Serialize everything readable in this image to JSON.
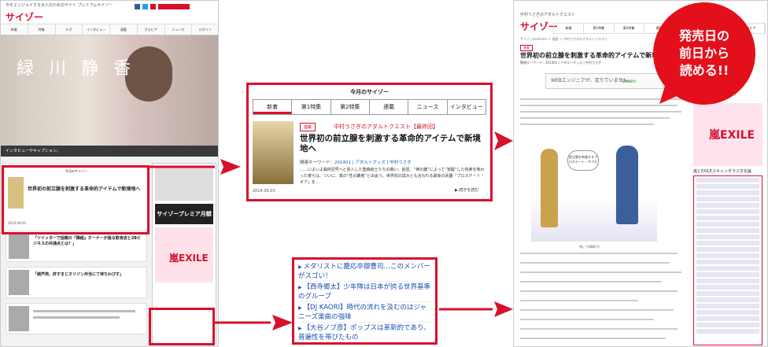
{
  "left_page": {
    "tagline": "今をエンジョイする大人のためのサイト プレミアムサイゾー",
    "logo": "サイゾー",
    "logo_sub": "premium",
    "nav": [
      "新着",
      "特集",
      "ルポ",
      "インタビュー",
      "連載",
      "グラビア",
      "ニュース",
      "ログイン"
    ],
    "hero_name": "緑 川 静 香",
    "hero_caption": "インタビューやキャプション。",
    "widget_header": "今月のサイゾー",
    "widget_tabs": [
      "新着",
      "第1特集",
      "第2特集",
      "連載",
      "ニュース",
      "インタビュー"
    ],
    "widget_title": "世界初の前立腺を刺激する革命的アイテムで新境地へ",
    "widget_date": "2014.09.03",
    "side_ad": "サイゾープレミア月額540円",
    "side_cover": "嵐EXILE",
    "news_titles": [
      "「ツイッターで話題の『隣組』オーナーが語る飲食店と2Bビジネスの共通点とは？」",
      "「諸芦苑、許すまじオリジン弁当にて待ちわびす」"
    ]
  },
  "popup_feature": {
    "header": "今月のサイゾー",
    "tabs": [
      "新着",
      "第1特集",
      "第2特集",
      "連載",
      "ニュース",
      "インタビュー"
    ],
    "badge": "連載",
    "category": "中村うさぎのアダルトクエスト【最終回】",
    "title": "世界初の前立腺を刺激する革命的アイテムで新境地へ",
    "keywords_label": "関連キーワード：",
    "keywords": "201401 | アダルトグッズ | 中村うさぎ",
    "body": "……いよいよ最終回号へと突入した重森純士たちの戦い。前回、“神の器”によって“覚醒”した快楽を味わった彼らは、ついに、真の“性の覇者”と出会う。世界初の試みとも言われる最後の武器「プロステート・ギア」を…",
    "date": "2014.09.03",
    "more": "▶ 続きを読む"
  },
  "popup_news": {
    "items": [
      "メダリストに慶応卒御曹司…このメンバーがスゴい！",
      "【西寺郷太】少年隊は日本が誇る世界基準のグループ",
      "【DJ KAORI】時代の流れを汲むのはジャニーズ楽曲の強味",
      "【大谷ノブ彦】ポップスは革新的であり、普遍性を帯びたもの"
    ]
  },
  "right_page": {
    "tagline": "中村うさぎのアダルトクエスト",
    "logo": "サイゾー",
    "nav": [
      "新着",
      "第1特集",
      "第2特集",
      "連載",
      "ニュース",
      "インタビュー",
      "グラビア"
    ],
    "breadcrumb": "サイゾーpremium ＞ 連載 ＞ 中村うさぎのアダルトクエスト",
    "badge": "連載",
    "title": "世界初の前立腺を刺激する革命的アイテムで新境地へ",
    "keywords": "関連キーワード：201401 | アダルトグッズ | 中村うさぎ",
    "ad_text": "WEBエンジニアが、足りていません。",
    "ad_brand": "Green",
    "illus_bubble": "前立腺を刺激するプロステート・ギアだ",
    "illus_caption": "（絵／大嶋昇子）",
    "side_cover": "嵐EXILE",
    "side_caption": "嵐とEXILEスキャンダラス文化論"
  },
  "callout": {
    "lines": [
      "発売日の",
      "前日から",
      "読める!!"
    ],
    "color": "#e3101c"
  },
  "accent_color": "#d8102c"
}
